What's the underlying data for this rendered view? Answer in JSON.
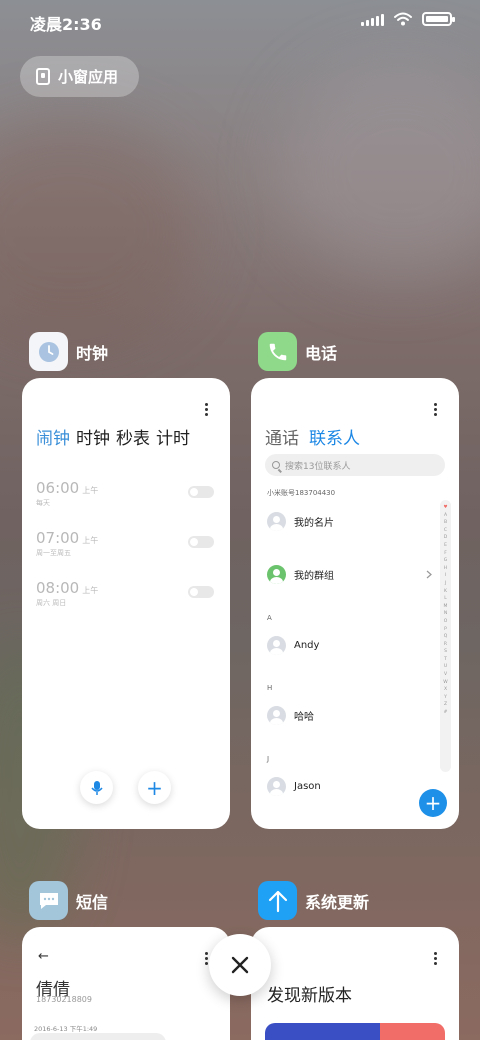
{
  "status_bar": {
    "time": "凌晨2:36",
    "icons": [
      "signal-icon",
      "wifi-icon",
      "battery-icon"
    ]
  },
  "small_window": {
    "label": "小窗应用",
    "icon": "small-window-icon"
  },
  "apps": {
    "clock": {
      "name": "时钟",
      "tabs": [
        "闹钟",
        "时钟",
        "秒表",
        "计时"
      ],
      "active_tab": 0,
      "alarms": [
        {
          "time": "06:00",
          "ampm": "上午",
          "repeat": "每天"
        },
        {
          "time": "07:00",
          "ampm": "上午",
          "repeat": "周一至周五"
        },
        {
          "time": "08:00",
          "ampm": "上午",
          "repeat": "周六 周日"
        }
      ],
      "mic_icon": "microphone-icon",
      "add_symbol": "+"
    },
    "phone": {
      "name": "电话",
      "tabs": [
        "通话",
        "联系人"
      ],
      "active_tab": 1,
      "search_placeholder": "搜索13位联系人",
      "account": "小米账号183704430",
      "my_card": "我的名片",
      "my_groups": "我的群组",
      "sections": [
        {
          "letter": "A",
          "name": "Andy"
        },
        {
          "letter": "H",
          "name": "哈哈"
        },
        {
          "letter": "J",
          "name": "Jason"
        }
      ],
      "alphabet": [
        "♥",
        "A",
        "B",
        "C",
        "D",
        "E",
        "F",
        "G",
        "H",
        "I",
        "J",
        "K",
        "L",
        "M",
        "N",
        "O",
        "P",
        "Q",
        "R",
        "S",
        "T",
        "U",
        "V",
        "W",
        "X",
        "Y",
        "Z",
        "#"
      ],
      "fab_symbol": "+"
    },
    "sms": {
      "name": "短信",
      "back_symbol": "←",
      "contact_name": "倩倩",
      "contact_number": "18730218809",
      "date": "2016-6-13 下午1:49"
    },
    "update": {
      "name": "系统更新",
      "title": "发现新版本"
    }
  },
  "colors": {
    "accent_blue": "#1e88e5",
    "clock_icon_bg": "#e8ecf3",
    "phone_icon_bg": "#8fd98a",
    "sms_icon_bg": "#a3c6da",
    "update_icon_bg": "#1fa1f5"
  },
  "close_button": {
    "icon": "close-icon"
  }
}
